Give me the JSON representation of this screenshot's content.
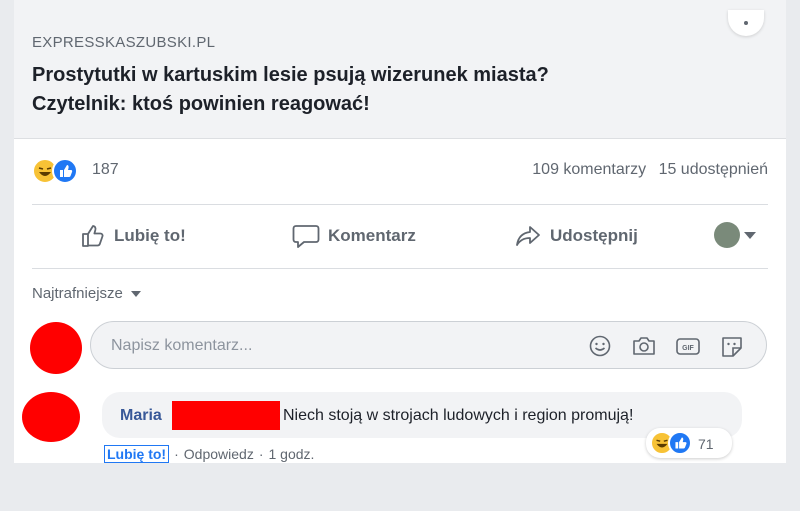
{
  "link_preview": {
    "domain": "EXPRESSKASZUBSKI.PL",
    "headline_line1": "Prostytutki w kartuskim lesie psują wizerunek miasta?",
    "headline_line2": "Czytelnik: ktoś powinien reagować!"
  },
  "reactions": {
    "icons": [
      "haha-reaction-icon",
      "like-reaction-icon"
    ],
    "count": "187",
    "comments": "109 komentarzy",
    "shares": "15 udostępnień"
  },
  "actions": {
    "like": "Lubię to!",
    "comment": "Komentarz",
    "share": "Udostępnij"
  },
  "sort": {
    "label": "Najtrafniejsze"
  },
  "composer": {
    "placeholder": "Napisz komentarz...",
    "icons": [
      "emoji-icon",
      "camera-icon",
      "gif-icon",
      "sticker-icon"
    ]
  },
  "comment": {
    "author": "Maria",
    "text": "Niech stoją w strojach ludowych i region promują!",
    "reaction_count": "71",
    "like_label": "Lubię to!",
    "reply_label": "Odpowiedz",
    "separator": "·",
    "time": "1 godz."
  },
  "colors": {
    "accent": "#385898",
    "like_blue": "#2078f4",
    "redaction": "#ff0000"
  }
}
